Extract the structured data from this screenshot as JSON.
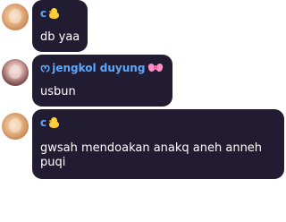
{
  "messages": [
    {
      "author": "c",
      "author_decoration": "chick-icon",
      "text": "db yaa"
    },
    {
      "author": "jengkol duyung",
      "author_prefix": "ᰔ",
      "author_decoration": "bow-icon",
      "text": "usbun"
    },
    {
      "author": "c",
      "author_decoration": "chick-icon",
      "text": "gwsah mendoakan anakq aneh anneh puqi"
    }
  ],
  "colors": {
    "bubble": "#221c33",
    "author_name": "#5aa9ff",
    "text": "#ffffff",
    "background": "#ffffff"
  }
}
